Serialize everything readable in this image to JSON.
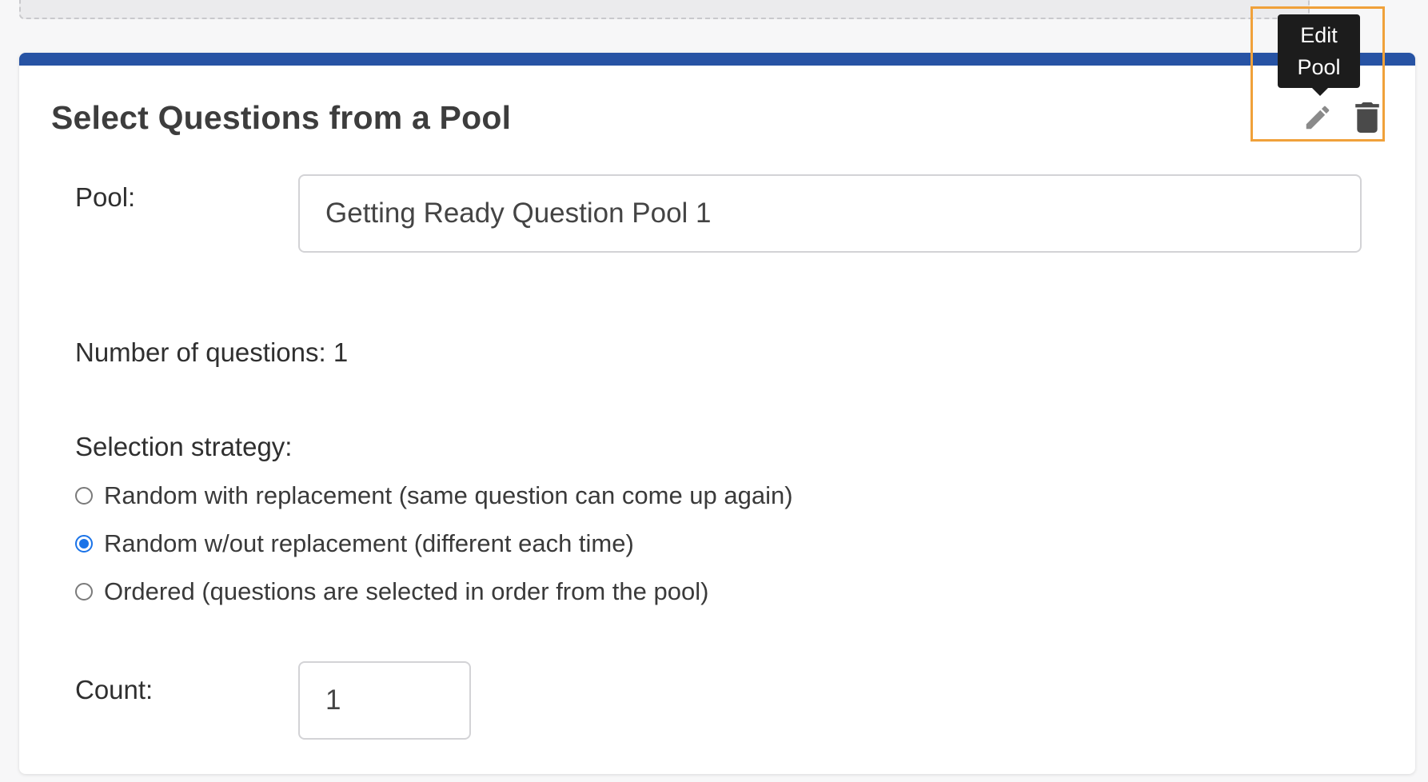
{
  "card": {
    "title": "Select Questions from a Pool",
    "tooltip": {
      "line1": "Edit",
      "line2": "Pool"
    },
    "icons": {
      "edit": "pencil-icon",
      "delete": "trash-icon"
    }
  },
  "form": {
    "pool_label": "Pool:",
    "pool_value": "Getting Ready Question Pool 1",
    "number_of_questions": "Number of questions: 1",
    "selection_strategy_label": "Selection strategy:",
    "strategies": [
      {
        "label": "Random with replacement (same question can come up again)",
        "selected": false
      },
      {
        "label": "Random w/out replacement (different each time)",
        "selected": true
      },
      {
        "label": "Ordered (questions are selected in order from the pool)",
        "selected": false
      }
    ],
    "count_label": "Count:",
    "count_value": "1"
  },
  "colors": {
    "header_bar": "#2753a4",
    "radio_selected": "#1a73e8",
    "highlight": "#f0a13a",
    "tooltip_bg": "#1c1c1c"
  }
}
